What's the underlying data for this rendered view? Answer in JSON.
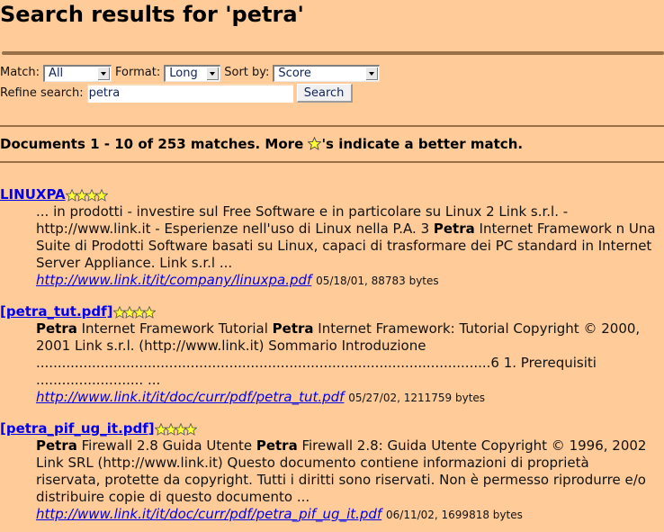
{
  "page": {
    "title": "Search results for 'petra'"
  },
  "form": {
    "match_label": "Match:",
    "match_value": "All",
    "format_label": "Format:",
    "format_value": "Long",
    "sortby_label": "Sort by:",
    "sortby_value": "Score",
    "refine_label": "Refine search:",
    "refine_value": "petra",
    "search_button": "Search"
  },
  "summary": {
    "prefix": "Documents 1 - 10 of 253 matches. More ",
    "star_icon": "star-icon",
    "suffix": "'s indicate a better match."
  },
  "results": [
    {
      "title": "LINUXPA",
      "stars": 4,
      "snippet_parts": [
        {
          "text": "... in prodotti - investire sul Free Software e in particolare su Linux 2 Link s.r.l. - http://www.link.it - Esperienze nell'uso di Linux nella P.A. 3 ",
          "bold": false
        },
        {
          "text": "Petra",
          "bold": true
        },
        {
          "text": " Internet Framework n Una Suite di Prodotti Software basati su Linux, capaci di trasformare dei PC standard in Internet Server Appliance. Link s.r.l  ...",
          "bold": false
        }
      ],
      "url": "http://www.link.it/it/company/linuxpa.pdf",
      "info": "05/18/01, 88783 bytes"
    },
    {
      "title": "[petra_tut.pdf]",
      "stars": 4,
      "snippet_parts": [
        {
          "text": "Petra",
          "bold": true
        },
        {
          "text": " Internet Framework Tutorial ",
          "bold": false
        },
        {
          "text": "Petra",
          "bold": true
        },
        {
          "text": " Internet Framework: Tutorial Copyright © 2000, 2001 Link s.r.l. (http://www.link.it) Sommario Introduzione ..........................................................................................................6 1. Prerequisiti ......................... ...",
          "bold": false
        }
      ],
      "url": "http://www.link.it/it/doc/curr/pdf/petra_tut.pdf",
      "info": "05/27/02, 1211759 bytes"
    },
    {
      "title": "[petra_pif_ug_it.pdf]",
      "stars": 4,
      "snippet_parts": [
        {
          "text": "Petra",
          "bold": true
        },
        {
          "text": " Firewall 2.8 Guida Utente ",
          "bold": false
        },
        {
          "text": "Petra",
          "bold": true
        },
        {
          "text": " Firewall 2.8: Guida Utente Copyright © 1996, 2002 Link SRL (http://www.link.it) Questo documento contiene informazioni di proprietà riservata, protette da copyright. Tutti i diritti sono riservati. Non è permesso riprodurre e/o distribuire copie di questo documento  ...",
          "bold": false
        }
      ],
      "url": "http://www.link.it/it/doc/curr/pdf/petra_pif_ug_it.pdf",
      "info": "06/11/02, 1699818 bytes"
    }
  ]
}
